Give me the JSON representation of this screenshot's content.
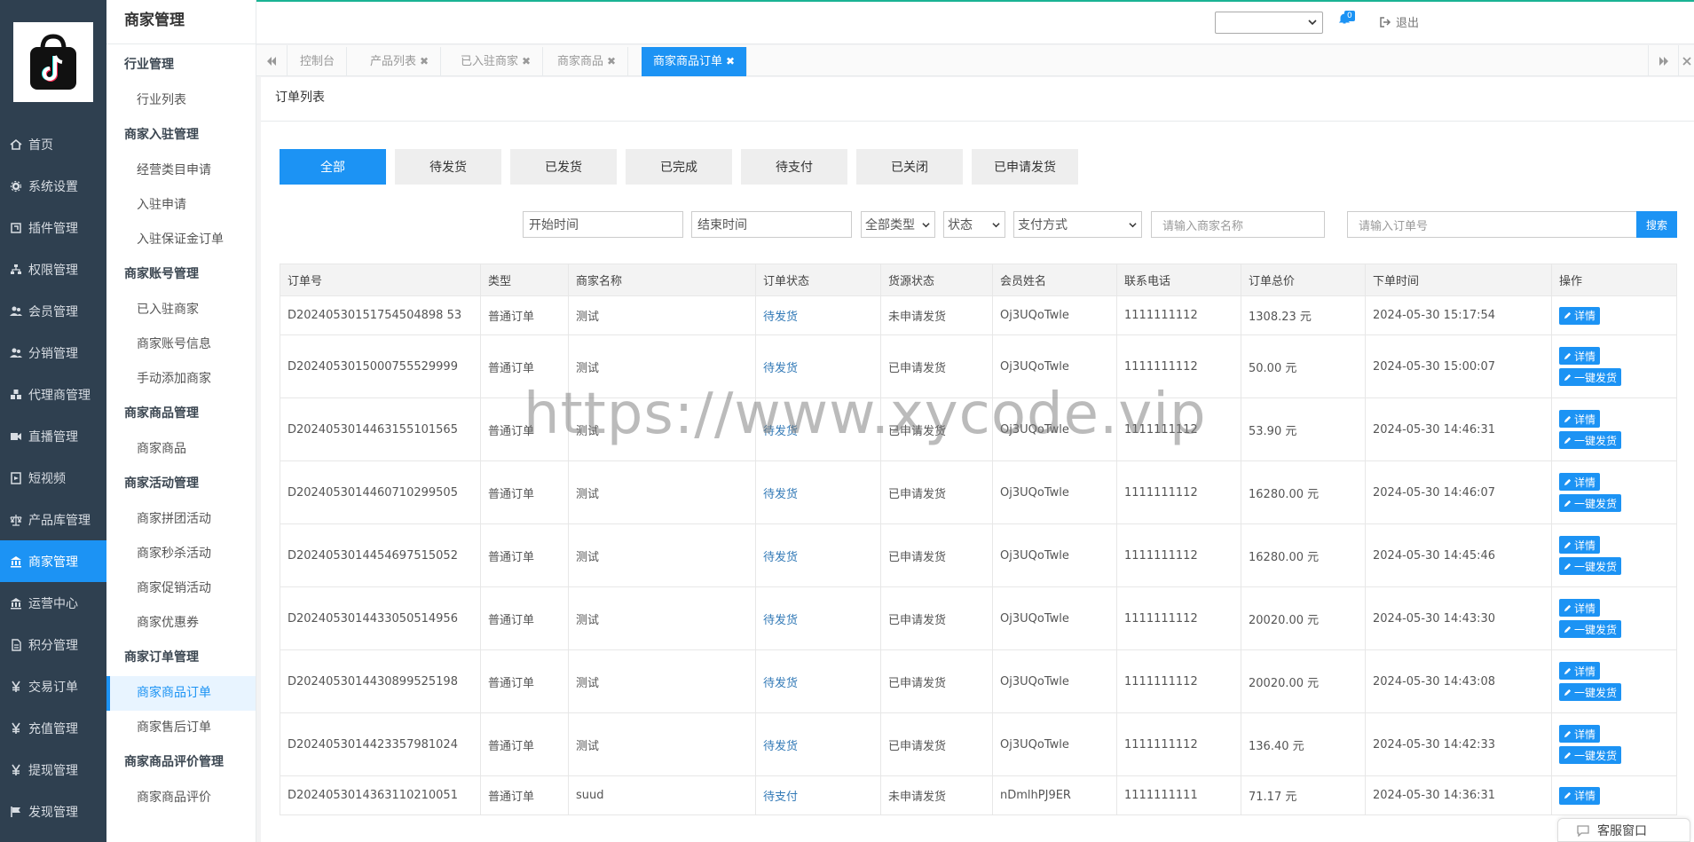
{
  "nav": {
    "items": [
      {
        "label": "首页",
        "icon": "home-icon"
      },
      {
        "label": "系统设置",
        "icon": "gear-icon"
      },
      {
        "label": "插件管理",
        "icon": "plugin-icon"
      },
      {
        "label": "权限管理",
        "icon": "sitemap-icon"
      },
      {
        "label": "会员管理",
        "icon": "users-icon"
      },
      {
        "label": "分销管理",
        "icon": "users-icon"
      },
      {
        "label": "代理商管理",
        "icon": "cubes-icon"
      },
      {
        "label": "直播管理",
        "icon": "video-icon"
      },
      {
        "label": "短视频",
        "icon": "film-icon"
      },
      {
        "label": "产品库管理",
        "icon": "balance-icon"
      },
      {
        "label": "商家管理",
        "icon": "bank-icon"
      },
      {
        "label": "运营中心",
        "icon": "bank-icon"
      },
      {
        "label": "积分管理",
        "icon": "file-icon"
      },
      {
        "label": "交易订单",
        "icon": "yen-icon"
      },
      {
        "label": "充值管理",
        "icon": "yen-icon"
      },
      {
        "label": "提现管理",
        "icon": "yen-icon"
      },
      {
        "label": "发现管理",
        "icon": "flag-icon"
      }
    ],
    "active_index": 10
  },
  "subnav": {
    "title": "商家管理",
    "groups": [
      {
        "label": "行业管理",
        "items": [
          "行业列表"
        ]
      },
      {
        "label": "商家入驻管理",
        "items": [
          "经营类目申请",
          "入驻申请",
          "入驻保证金订单"
        ]
      },
      {
        "label": "商家账号管理",
        "items": [
          "已入驻商家",
          "商家账号信息",
          "手动添加商家"
        ]
      },
      {
        "label": "商家商品管理",
        "items": [
          "商家商品"
        ]
      },
      {
        "label": "商家活动管理",
        "items": [
          "商家拼团活动",
          "商家秒杀活动",
          "商家促销活动",
          "商家优惠券"
        ]
      },
      {
        "label": "商家订单管理",
        "items": [
          "商家商品订单",
          "商家售后订单"
        ]
      },
      {
        "label": "商家商品评价管理",
        "items": [
          "商家商品评价"
        ]
      }
    ],
    "active_item": "商家商品订单"
  },
  "topbar": {
    "badge_count": "0",
    "logout_label": "退出"
  },
  "tabs": [
    {
      "label": "控制台",
      "closable": false
    },
    {
      "label": "产品列表",
      "closable": true
    },
    {
      "label": "已入驻商家",
      "closable": true
    },
    {
      "label": "商家商品",
      "closable": true
    },
    {
      "label": "商家商品订单",
      "closable": true,
      "active": true
    }
  ],
  "panel": {
    "title": "订单列表"
  },
  "status_filters": [
    "全部",
    "待发货",
    "已发货",
    "已完成",
    "待支付",
    "已关闭",
    "已申请发货"
  ],
  "filters": {
    "start_time": "开始时间",
    "end_time": "结束时间",
    "type_select": "全部类型",
    "status_select": "状态",
    "pay_select": "支付方式",
    "merchant_placeholder": "请输入商家名称",
    "order_placeholder": "请输入订单号",
    "search_label": "搜索"
  },
  "table": {
    "headers": [
      "订单号",
      "类型",
      "商家名称",
      "订单状态",
      "货源状态",
      "会员姓名",
      "联系电话",
      "订单总价",
      "下单时间",
      "操作"
    ],
    "detail_label": "详情",
    "ship_label": "一键发货",
    "rows": [
      {
        "order_no": "D20240530151754504898 53",
        "type": "普通订单",
        "merchant": "测试",
        "status": "待发货",
        "source": "未申请发货",
        "member": "Oj3UQoTwle",
        "phone": "1111111112",
        "total": "1308.23 元",
        "time": "2024-05-30 15:17:54",
        "ship": false
      },
      {
        "order_no": "D2024053015000755529999",
        "type": "普通订单",
        "merchant": "测试",
        "status": "待发货",
        "source": "已申请发货",
        "member": "Oj3UQoTwle",
        "phone": "1111111112",
        "total": "50.00 元",
        "time": "2024-05-30 15:00:07",
        "ship": true
      },
      {
        "order_no": "D2024053014463155101565",
        "type": "普通订单",
        "merchant": "测试",
        "status": "待发货",
        "source": "已申请发货",
        "member": "Oj3UQoTwle",
        "phone": "1111111112",
        "total": "53.90 元",
        "time": "2024-05-30 14:46:31",
        "ship": true
      },
      {
        "order_no": "D2024053014460710299505",
        "type": "普通订单",
        "merchant": "测试",
        "status": "待发货",
        "source": "已申请发货",
        "member": "Oj3UQoTwle",
        "phone": "1111111112",
        "total": "16280.00 元",
        "time": "2024-05-30 14:46:07",
        "ship": true
      },
      {
        "order_no": "D2024053014454697515052",
        "type": "普通订单",
        "merchant": "测试",
        "status": "待发货",
        "source": "已申请发货",
        "member": "Oj3UQoTwle",
        "phone": "1111111112",
        "total": "16280.00 元",
        "time": "2024-05-30 14:45:46",
        "ship": true
      },
      {
        "order_no": "D2024053014433050514956",
        "type": "普通订单",
        "merchant": "测试",
        "status": "待发货",
        "source": "已申请发货",
        "member": "Oj3UQoTwle",
        "phone": "1111111112",
        "total": "20020.00 元",
        "time": "2024-05-30 14:43:30",
        "ship": true
      },
      {
        "order_no": "D2024053014430899525198",
        "type": "普通订单",
        "merchant": "测试",
        "status": "待发货",
        "source": "已申请发货",
        "member": "Oj3UQoTwle",
        "phone": "1111111112",
        "total": "20020.00 元",
        "time": "2024-05-30 14:43:08",
        "ship": true
      },
      {
        "order_no": "D2024053014423357981024",
        "type": "普通订单",
        "merchant": "测试",
        "status": "待发货",
        "source": "已申请发货",
        "member": "Oj3UQoTwle",
        "phone": "1111111112",
        "total": "136.40 元",
        "time": "2024-05-30 14:42:33",
        "ship": true
      },
      {
        "order_no": "D2024053014363110210051",
        "type": "普通订单",
        "merchant": "suud",
        "status": "待支付",
        "source": "未申请发货",
        "member": "nDmlhPJ9ER",
        "phone": "1111111111",
        "total": "71.17 元",
        "time": "2024-05-30 14:36:31",
        "ship": false
      }
    ]
  },
  "watermark": "https://www.xycode.vip",
  "service_label": "客服窗口",
  "colors": {
    "primary": "#1c93f4",
    "sidebar": "#2f4050",
    "link": "#337ab7"
  }
}
